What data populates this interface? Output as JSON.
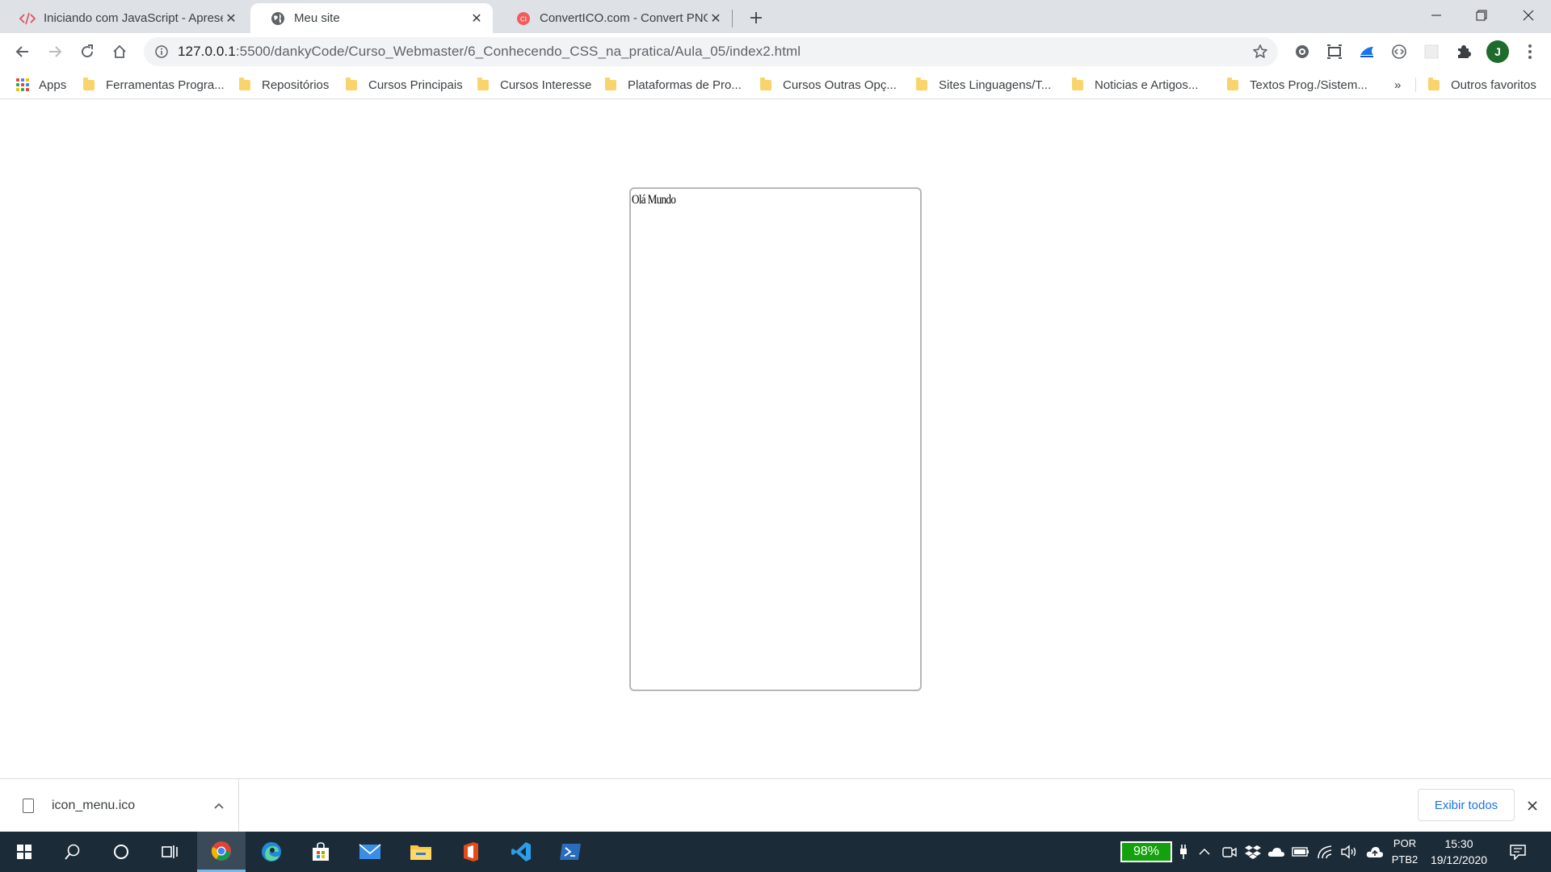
{
  "browser": {
    "tabs": [
      {
        "title": "Iniciando com JavaScript - Apresentação",
        "favicon": "code-icon",
        "active": false
      },
      {
        "title": "Meu site",
        "favicon": "globe-icon",
        "active": true
      },
      {
        "title": "ConvertICO.com - Convert PNG to ICO",
        "favicon": "converticoicon",
        "active": false
      }
    ],
    "address_bar": {
      "host": "127.0.0.1",
      "path": ":5500/dankyCode/Curso_Webmaster/6_Conhecendo_CSS_na_pratica/Aula_05/index2.html"
    },
    "profile_initial": "J",
    "accent_color": "#1a73e8"
  },
  "bookmarks": {
    "apps_label": "Apps",
    "items": [
      "Ferramentas Progra...",
      "Repositórios",
      "Cursos Principais",
      "Cursos Interesse",
      "Plataformas de Pro...",
      "Cursos Outras Opç...",
      "Sites Linguagens/T...",
      "Noticias e Artigos...",
      "Textos Prog./Sistem..."
    ],
    "overflow_label": "»",
    "other_label": "Outros favoritos"
  },
  "page": {
    "box_text": "Olá Mundo"
  },
  "downloads": {
    "file_name": "icon_menu.ico",
    "show_all_label": "Exibir todos"
  },
  "taskbar": {
    "battery": "98%",
    "lang_line1": "POR",
    "lang_line2": "PTB2",
    "time": "15:30",
    "date": "19/12/2020"
  }
}
